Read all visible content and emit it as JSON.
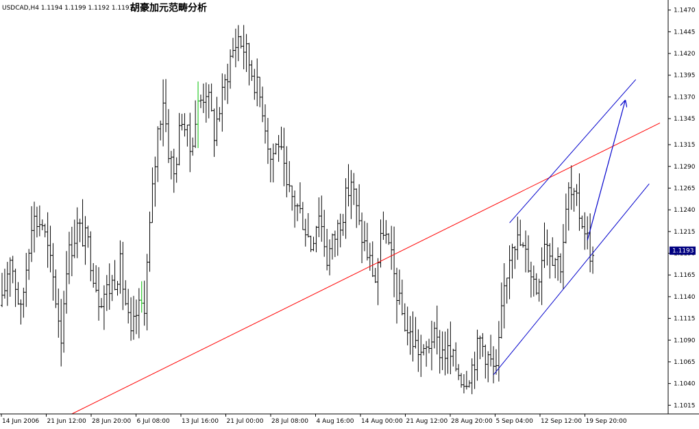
{
  "header": {
    "symbol_line": "USDCAD,H4  1.1194 1.1199 1.1192 1.1193",
    "title": "胡豪加元范畴分析"
  },
  "current_price_label": "1.1193",
  "colors": {
    "background": "#ffffff",
    "bars": "#000000",
    "up_highlight": "#00c000",
    "trend_red": "#ff0000",
    "channel_blue": "#0000cc",
    "badge_bg": "#000080"
  },
  "chart_data": {
    "type": "ohlc-bar",
    "symbol": "USDCAD",
    "timeframe": "H4",
    "last": {
      "open": 1.1194,
      "high": 1.1199,
      "low": 1.1192,
      "close": 1.1193
    },
    "ylim": [
      1.1005,
      1.148
    ],
    "y_ticks": [
      "1.1470",
      "1.1445",
      "1.1420",
      "1.1395",
      "1.1370",
      "1.1345",
      "1.1315",
      "1.1290",
      "1.1265",
      "1.1240",
      "1.1215",
      "1.1190",
      "1.1165",
      "1.1140",
      "1.1115",
      "1.1090",
      "1.1065",
      "1.1040",
      "1.1015"
    ],
    "x_ticks": [
      "14 Jun 2006",
      "21 Jun 12:00",
      "28 Jun 20:00",
      "6 Jul 08:00",
      "13 Jul 16:00",
      "21 Jul 00:00",
      "28 Jul 08:00",
      "4 Aug 16:00",
      "14 Aug 00:00",
      "21 Aug 12:00",
      "28 Aug 20:00",
      "5 Sep 04:00",
      "12 Sep 12:00",
      "19 Sep 20:00"
    ],
    "bar_count": 245,
    "anchors": [
      [
        0,
        1.113
      ],
      [
        3,
        1.119
      ],
      [
        7,
        1.112
      ],
      [
        11,
        1.123
      ],
      [
        15,
        1.1225
      ],
      [
        19,
        1.116
      ],
      [
        22,
        1.1095
      ],
      [
        24,
        1.118
      ],
      [
        28,
        1.122
      ],
      [
        32,
        1.12
      ],
      [
        36,
        1.114
      ],
      [
        40,
        1.115
      ],
      [
        44,
        1.1175
      ],
      [
        48,
        1.109
      ],
      [
        50,
        1.112
      ],
      [
        53,
        1.1135
      ],
      [
        56,
        1.126
      ],
      [
        58,
        1.133
      ],
      [
        60,
        1.137
      ],
      [
        62,
        1.131
      ],
      [
        64,
        1.128
      ],
      [
        67,
        1.135
      ],
      [
        70,
        1.131
      ],
      [
        73,
        1.136
      ],
      [
        76,
        1.138
      ],
      [
        79,
        1.133
      ],
      [
        82,
        1.137
      ],
      [
        85,
        1.1415
      ],
      [
        88,
        1.144
      ],
      [
        91,
        1.142
      ],
      [
        94,
        1.139
      ],
      [
        97,
        1.136
      ],
      [
        100,
        1.13
      ],
      [
        103,
        1.132
      ],
      [
        106,
        1.126
      ],
      [
        109,
        1.125
      ],
      [
        112,
        1.123
      ],
      [
        115,
        1.12
      ],
      [
        118,
        1.124
      ],
      [
        121,
        1.1185
      ],
      [
        124,
        1.121
      ],
      [
        127,
        1.124
      ],
      [
        130,
        1.1275
      ],
      [
        133,
        1.122
      ],
      [
        136,
        1.119
      ],
      [
        139,
        1.116
      ],
      [
        142,
        1.122
      ],
      [
        145,
        1.118
      ],
      [
        148,
        1.113
      ],
      [
        151,
        1.11
      ],
      [
        154,
        1.1085
      ],
      [
        157,
        1.107
      ],
      [
        160,
        1.1095
      ],
      [
        163,
        1.108
      ],
      [
        166,
        1.1075
      ],
      [
        169,
        1.106
      ],
      [
        172,
        1.1045
      ],
      [
        175,
        1.106
      ],
      [
        178,
        1.109
      ],
      [
        181,
        1.107
      ],
      [
        184,
        1.105
      ],
      [
        187,
        1.115
      ],
      [
        190,
        1.121
      ],
      [
        193,
        1.12
      ],
      [
        196,
        1.118
      ],
      [
        199,
        1.115
      ],
      [
        202,
        1.121
      ],
      [
        205,
        1.119
      ],
      [
        208,
        1.118
      ],
      [
        211,
        1.126
      ],
      [
        214,
        1.1245
      ],
      [
        217,
        1.122
      ],
      [
        220,
        1.118
      ]
    ],
    "annotations": [
      {
        "type": "trendline",
        "color": "red",
        "points": [
          [
            1.1005,
            26
          ],
          [
            1.134,
            245
          ]
        ]
      },
      {
        "type": "trendline",
        "color": "blue",
        "points": [
          [
            1.105,
            183
          ],
          [
            1.127,
            241
          ]
        ]
      },
      {
        "type": "trendline",
        "color": "blue",
        "points": [
          [
            1.1225,
            189
          ],
          [
            1.139,
            236
          ]
        ]
      },
      {
        "type": "arrow",
        "color": "blue",
        "from": [
          1.1205,
          218
        ],
        "to": [
          1.1365,
          232
        ]
      }
    ]
  }
}
